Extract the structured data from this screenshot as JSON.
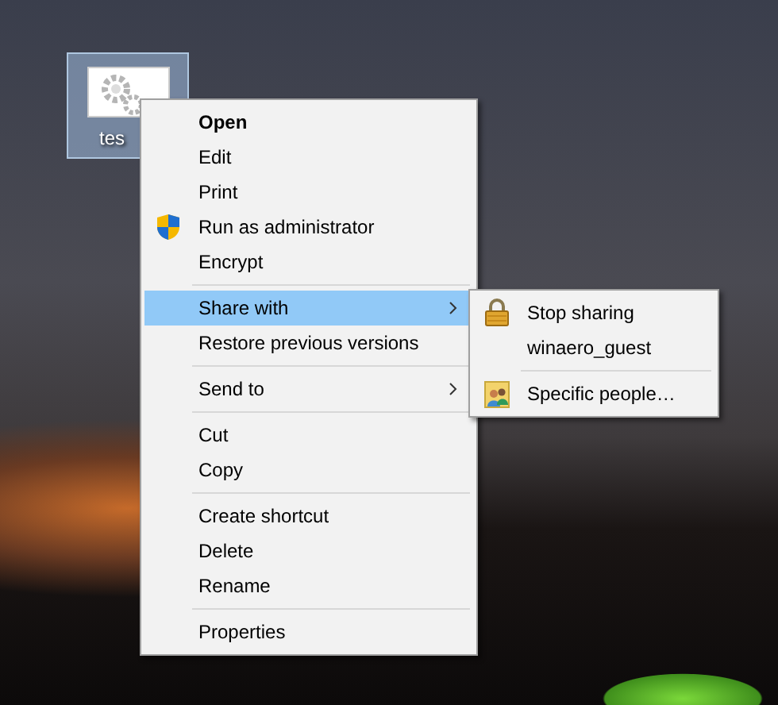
{
  "desktop_icon": {
    "label": "tes",
    "selected": true
  },
  "context_menu": {
    "groups": [
      {
        "items": [
          {
            "label": "Open",
            "kind": "plain",
            "default": true,
            "selected": false
          },
          {
            "label": "Edit",
            "kind": "plain",
            "default": false,
            "selected": false
          },
          {
            "label": "Print",
            "kind": "plain",
            "default": false,
            "selected": false
          },
          {
            "label": "Run as administrator",
            "kind": "shield",
            "default": false,
            "selected": false
          },
          {
            "label": "Encrypt",
            "kind": "plain",
            "default": false,
            "selected": false
          }
        ]
      },
      {
        "items": [
          {
            "label": "Share with",
            "kind": "submenu",
            "default": false,
            "selected": true
          },
          {
            "label": "Restore previous versions",
            "kind": "plain",
            "default": false,
            "selected": false
          }
        ]
      },
      {
        "items": [
          {
            "label": "Send to",
            "kind": "submenu",
            "default": false,
            "selected": false
          }
        ]
      },
      {
        "items": [
          {
            "label": "Cut",
            "kind": "plain",
            "default": false,
            "selected": false
          },
          {
            "label": "Copy",
            "kind": "plain",
            "default": false,
            "selected": false
          }
        ]
      },
      {
        "items": [
          {
            "label": "Create shortcut",
            "kind": "plain",
            "default": false,
            "selected": false
          },
          {
            "label": "Delete",
            "kind": "plain",
            "default": false,
            "selected": false
          },
          {
            "label": "Rename",
            "kind": "plain",
            "default": false,
            "selected": false
          }
        ]
      },
      {
        "items": [
          {
            "label": "Properties",
            "kind": "plain",
            "default": false,
            "selected": false
          }
        ]
      }
    ]
  },
  "submenu": {
    "groups": [
      {
        "items": [
          {
            "label": "Stop sharing",
            "kind": "lock",
            "default": false,
            "selected": false
          },
          {
            "label": "winaero_guest",
            "kind": "plain",
            "default": false,
            "selected": false
          }
        ]
      },
      {
        "items": [
          {
            "label": "Specific people…",
            "kind": "people",
            "default": false,
            "selected": false
          }
        ]
      }
    ]
  }
}
